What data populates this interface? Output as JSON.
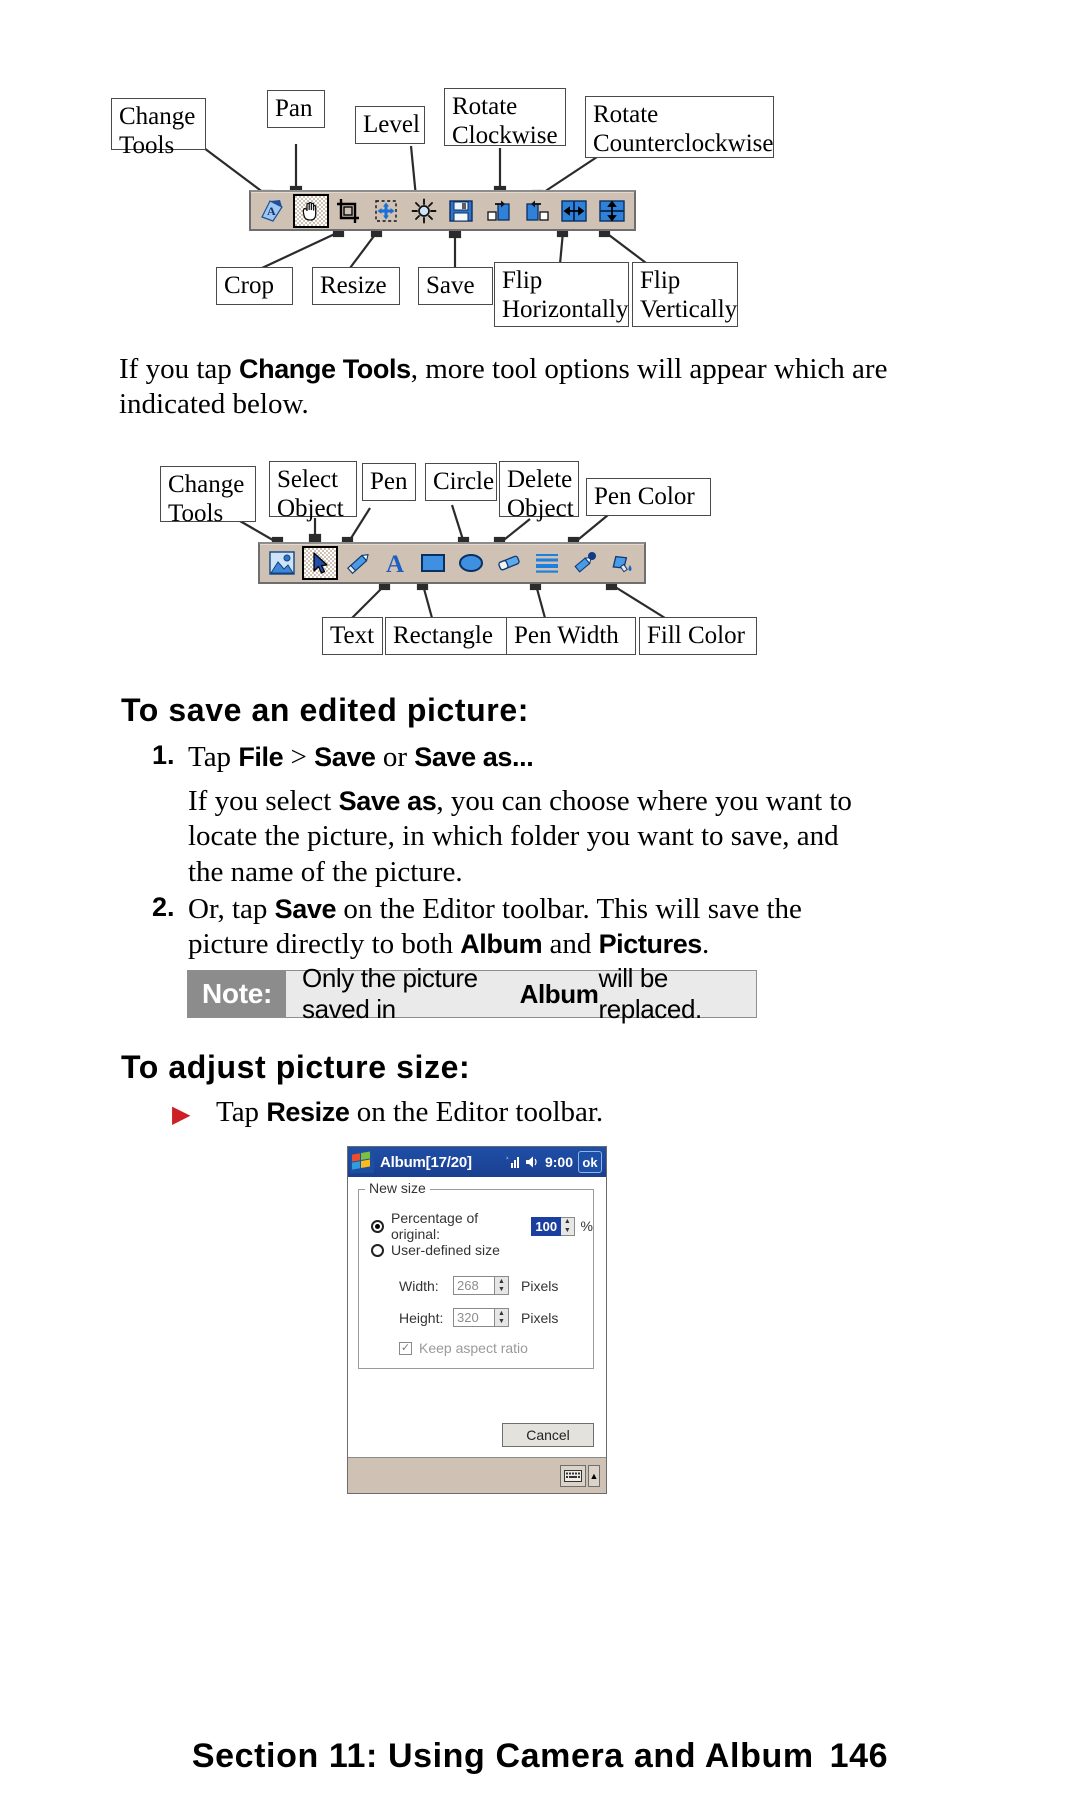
{
  "page": {
    "footer_title": "Section 11: Using Camera and Album",
    "page_number": "146"
  },
  "editor_toolbar_diagram": {
    "callouts_top": [
      {
        "name": "change-tools",
        "lines": [
          "Change",
          "Tools"
        ]
      },
      {
        "name": "pan",
        "lines": [
          "Pan"
        ]
      },
      {
        "name": "level",
        "lines": [
          "Level"
        ]
      },
      {
        "name": "rotate-clockwise",
        "lines": [
          "Rotate",
          "Clockwise"
        ]
      },
      {
        "name": "rotate-counterclockwise",
        "lines": [
          "Rotate",
          "Counterclockwise"
        ]
      }
    ],
    "callouts_bottom": [
      {
        "name": "crop",
        "lines": [
          "Crop"
        ]
      },
      {
        "name": "resize",
        "lines": [
          "Resize"
        ]
      },
      {
        "name": "save",
        "lines": [
          "Save"
        ]
      },
      {
        "name": "flip-horizontally",
        "lines": [
          "Flip",
          "Horizontally"
        ]
      },
      {
        "name": "flip-vertically",
        "lines": [
          "Flip",
          "Vertically"
        ]
      }
    ],
    "buttons": [
      "change-tools-icon",
      "pan-hand-icon",
      "crop-icon",
      "resize-icon",
      "level-brightness-icon",
      "save-disk-icon",
      "rotate-clockwise-icon",
      "rotate-counterclockwise-icon",
      "flip-horizontal-icon",
      "flip-vertical-icon"
    ],
    "selected_button": "pan-hand-icon"
  },
  "intro_text": {
    "before": "If you tap ",
    "bold": "Change Tools",
    "after": ", more tool options will appear which are indicated below."
  },
  "tools_toolbar_diagram": {
    "callouts_top": [
      {
        "name": "change-tools",
        "lines": [
          "Change",
          "Tools"
        ]
      },
      {
        "name": "select-object",
        "lines": [
          "Select",
          "Object"
        ]
      },
      {
        "name": "pen",
        "lines": [
          "Pen"
        ]
      },
      {
        "name": "circle",
        "lines": [
          "Circle"
        ]
      },
      {
        "name": "delete-object",
        "lines": [
          "Delete",
          "Object"
        ]
      },
      {
        "name": "pen-color",
        "lines": [
          "Pen Color"
        ]
      }
    ],
    "callouts_bottom": [
      {
        "name": "text",
        "lines": [
          "Text"
        ]
      },
      {
        "name": "rectangle",
        "lines": [
          "Rectangle"
        ]
      },
      {
        "name": "pen-width",
        "lines": [
          "Pen Width"
        ]
      },
      {
        "name": "fill-color",
        "lines": [
          "Fill Color"
        ]
      }
    ],
    "buttons": [
      "change-tools-icon",
      "select-object-arrow-icon",
      "pen-icon",
      "text-a-icon",
      "rectangle-icon",
      "circle-icon",
      "eraser-icon",
      "pen-width-icon",
      "pen-color-icon",
      "fill-color-icon"
    ],
    "selected_button": "select-object-arrow-icon"
  },
  "save_section": {
    "heading": "To save an edited picture:",
    "steps": [
      {
        "number": "1.",
        "segments": [
          {
            "t": "Tap ",
            "b": false
          },
          {
            "t": "File",
            "b": true
          },
          {
            "t": " > ",
            "b": false
          },
          {
            "t": "Save",
            "b": true
          },
          {
            "t": " or ",
            "b": false
          },
          {
            "t": "Save as...",
            "b": true
          }
        ],
        "body": [
          {
            "t": "If you select ",
            "b": false
          },
          {
            "t": "Save as",
            "b": true
          },
          {
            "t": ", you can choose where you want to locate the picture, in which folder you want to save, and the name of the picture.",
            "b": false
          }
        ]
      },
      {
        "number": "2.",
        "segments": [
          {
            "t": "Or, tap ",
            "b": false
          },
          {
            "t": "Save",
            "b": true
          },
          {
            "t": " on the Editor toolbar. This will save the picture directly to both ",
            "b": false
          },
          {
            "t": "Album",
            "b": true
          },
          {
            "t": " and ",
            "b": false
          },
          {
            "t": "Pictures",
            "b": true
          },
          {
            "t": ".",
            "b": false
          }
        ]
      }
    ]
  },
  "note": {
    "tag": "Note:",
    "segments": [
      {
        "t": "Only the picture saved in ",
        "b": false
      },
      {
        "t": "Album",
        "b": true
      },
      {
        "t": " will be replaced.",
        "b": false
      }
    ]
  },
  "adjust_section": {
    "heading": "To adjust picture size:",
    "bullet_segments": [
      {
        "t": "Tap ",
        "b": false
      },
      {
        "t": "Resize",
        "b": true
      },
      {
        "t": " on the Editor toolbar.",
        "b": false
      }
    ],
    "bullet_color": "#cc2026"
  },
  "pda_screenshot": {
    "title": "Album[17/20]",
    "clock": "9:00",
    "ok_label": "ok",
    "group_label": "New size",
    "percentage_label": "Percentage of original:",
    "percentage_value": "100",
    "percent_sign": "%",
    "user_defined_label": "User-defined size",
    "width_label": "Width:",
    "width_value": "268",
    "width_unit": "Pixels",
    "height_label": "Height:",
    "height_value": "320",
    "height_unit": "Pixels",
    "keep_aspect_label": "Keep aspect ratio",
    "cancel_label": "Cancel",
    "selected_radio": "percentage-of-original",
    "keep_aspect_checked": true
  }
}
